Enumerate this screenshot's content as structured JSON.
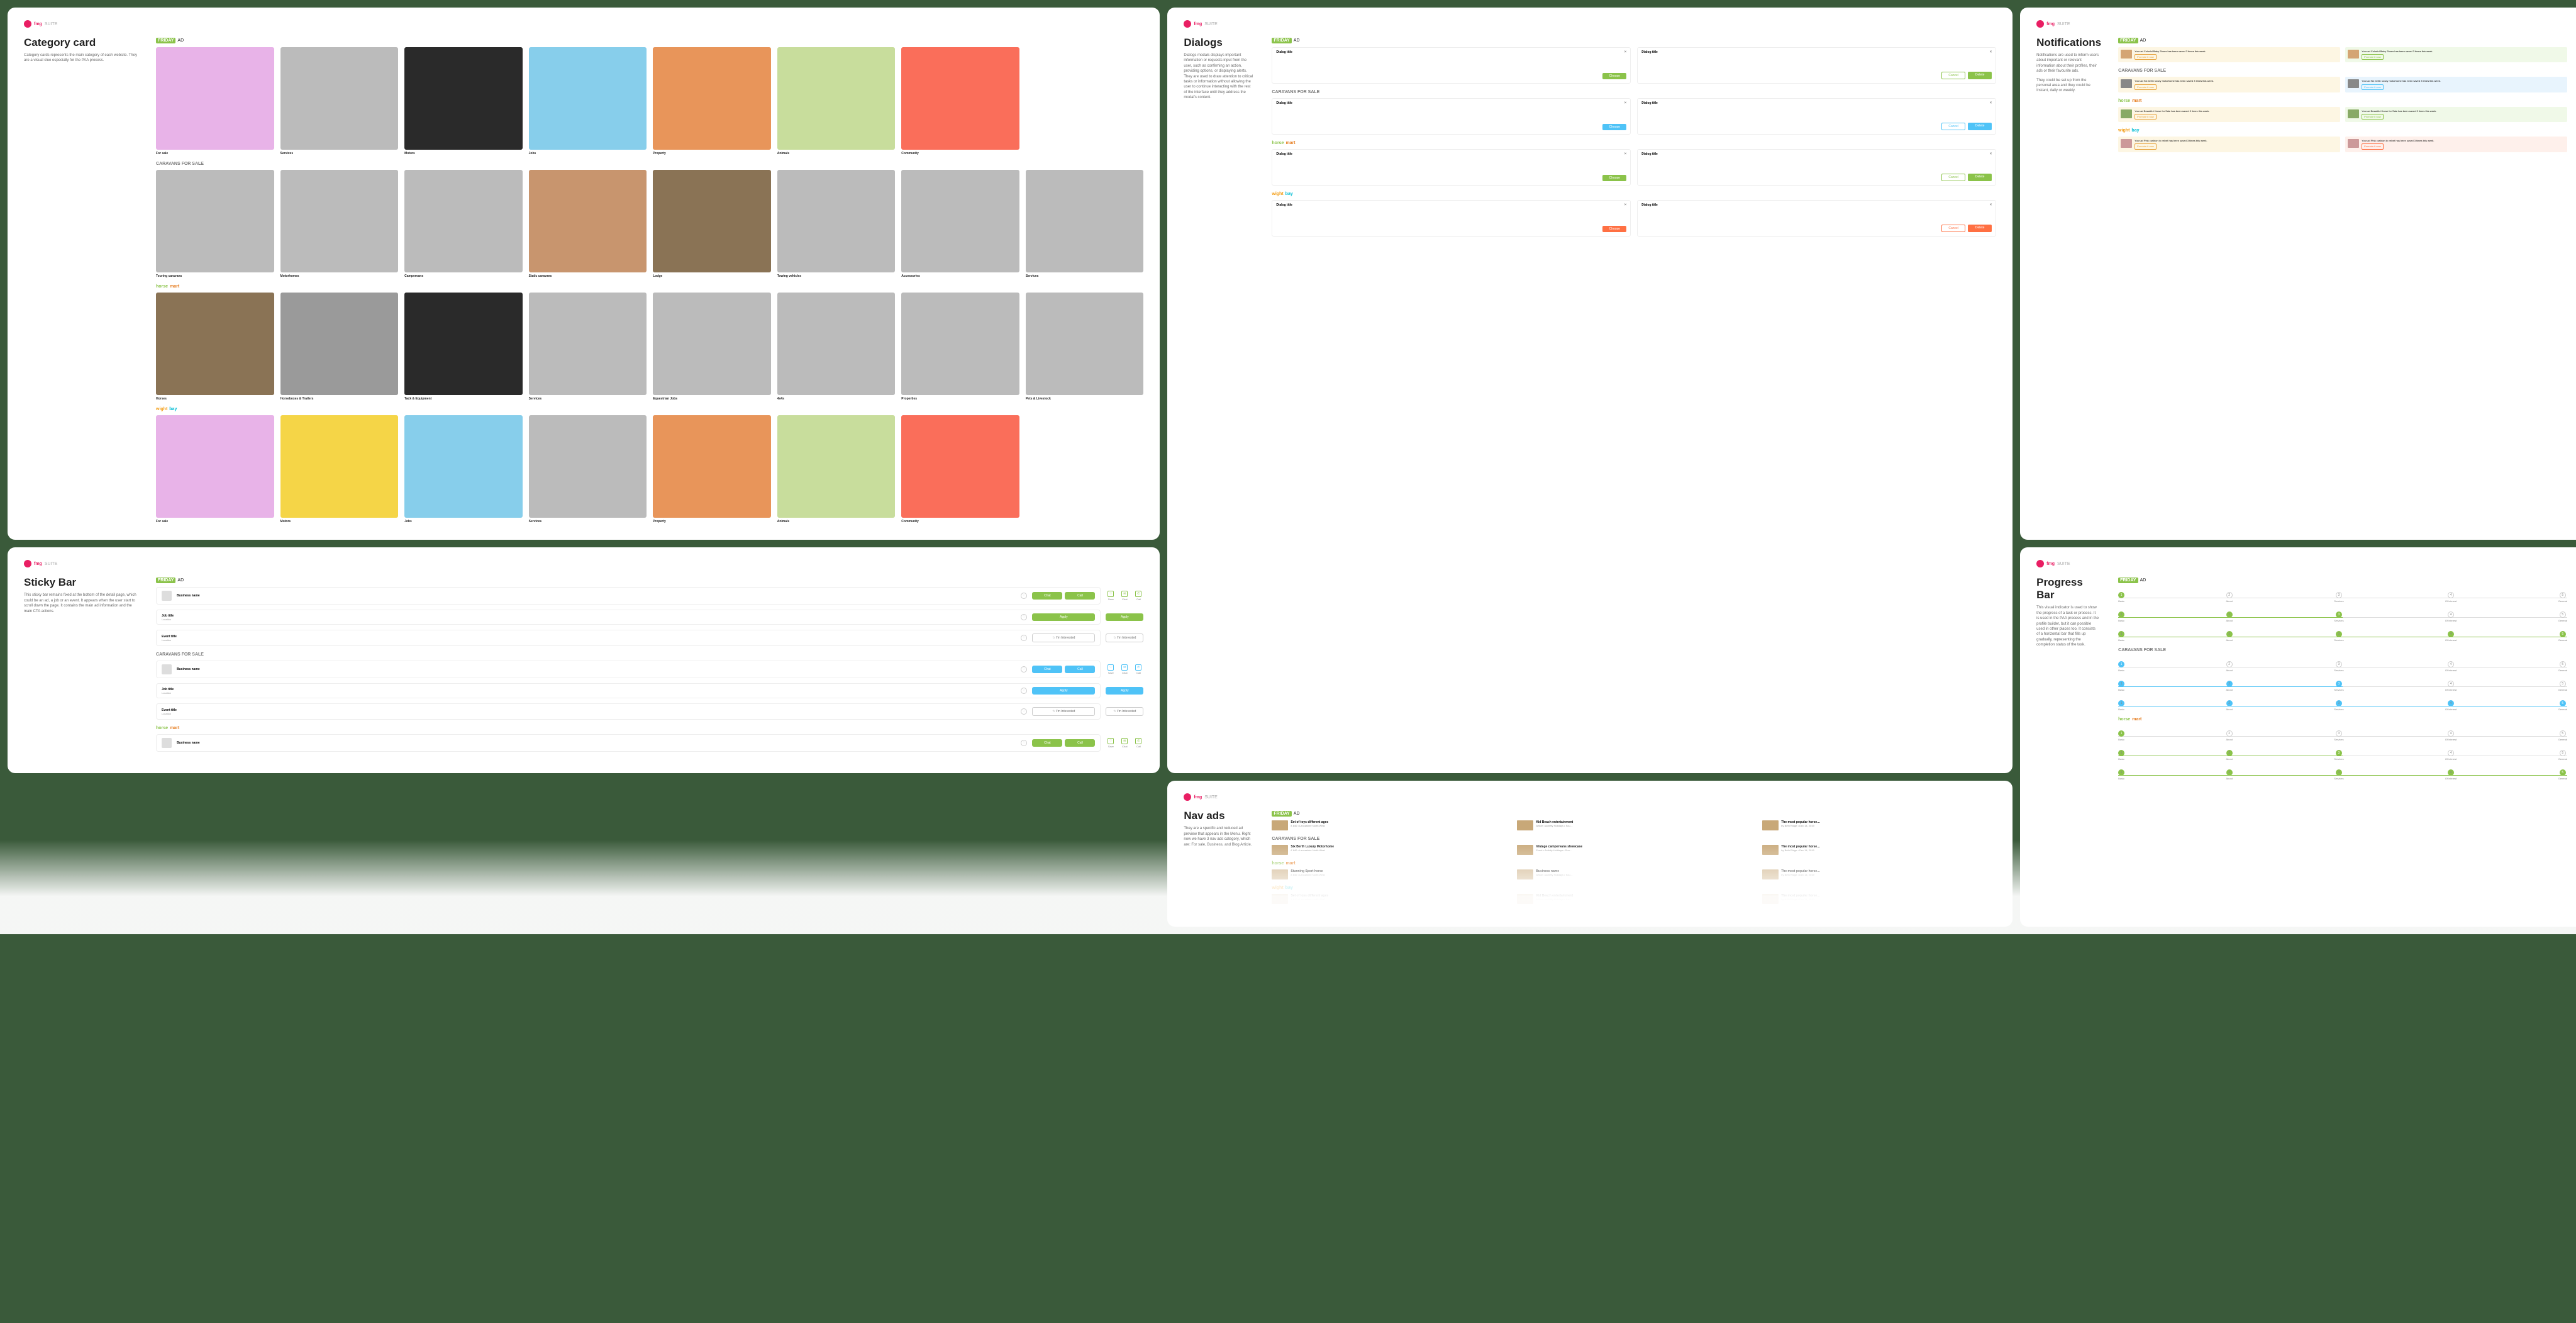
{
  "logo": {
    "brand": "fmg",
    "sub": "SUITE"
  },
  "brands": {
    "friday": "FRIDAY",
    "fridayAd": "AD",
    "caravans": "CARAVANS FOR SALE",
    "horsemart": "horsemart",
    "wightbay": "wightbay"
  },
  "categoryCard": {
    "title": "Category card",
    "desc": "Category cards represents the main category of each website. They are a visual clue especially for the PAA process.",
    "r1": [
      {
        "l": "For sale",
        "c": "c-pink"
      },
      {
        "l": "Services",
        "c": "c-gray"
      },
      {
        "l": "Motors",
        "c": "c-dark"
      },
      {
        "l": "Jobs",
        "c": "c-blue"
      },
      {
        "l": "Property",
        "c": "c-orange"
      },
      {
        "l": "Animals",
        "c": "c-green"
      },
      {
        "l": "Community",
        "c": "c-salmon"
      }
    ],
    "r2": [
      {
        "l": "Touring caravans",
        "c": "c-gray"
      },
      {
        "l": "Motorhomes",
        "c": "c-gray"
      },
      {
        "l": "Campervans",
        "c": "c-gray"
      },
      {
        "l": "Static caravans",
        "c": "c-warm"
      },
      {
        "l": "Lodge",
        "c": "c-brown"
      },
      {
        "l": "Towing vehicles",
        "c": "c-gray"
      },
      {
        "l": "Accessories",
        "c": "c-gray"
      },
      {
        "l": "Services",
        "c": "c-gray"
      }
    ],
    "r3": [
      {
        "l": "Horses",
        "c": "c-brown"
      },
      {
        "l": "Horseboxes & Trailers",
        "c": "c-grayish"
      },
      {
        "l": "Tack & Equipment",
        "c": "c-dark"
      },
      {
        "l": "Services",
        "c": "c-gray"
      },
      {
        "l": "Equestrian Jobs",
        "c": "c-gray"
      },
      {
        "l": "4x4s",
        "c": "c-gray"
      },
      {
        "l": "Properties",
        "c": "c-gray"
      },
      {
        "l": "Pets & Livestock",
        "c": "c-gray"
      }
    ],
    "r4": [
      {
        "l": "For sale",
        "c": "c-pink"
      },
      {
        "l": "Motors",
        "c": "c-yellow"
      },
      {
        "l": "Jobs",
        "c": "c-blue"
      },
      {
        "l": "Services",
        "c": "c-gray"
      },
      {
        "l": "Property",
        "c": "c-orange"
      },
      {
        "l": "Animals",
        "c": "c-green"
      },
      {
        "l": "Community",
        "c": "c-salmon"
      }
    ]
  },
  "stickyBar": {
    "title": "Sticky Bar",
    "desc": "This sticky bar remains fixed at the bottom of the detail page, which could be an ad, a job or an event. It appears when the user start to scroll down the page. It contains the main ad information and the main CTA actions.",
    "fields": {
      "business": "Business name",
      "job": "Job title",
      "event": "Event title",
      "loc": "Location"
    },
    "btns": {
      "chat": "Chat",
      "call": "Call",
      "apply": "Apply",
      "interested": "I’m Interested",
      "save": "Save"
    }
  },
  "dialogs": {
    "title": "Dialogs",
    "desc": "Dialogs modals displays important information or requests input from the user, such as confirming an action, providing options, or displaying alerts. They are used to draw attention to critical tasks or information without allowing the user to continue interacting with the rest of the interface until they address the modal's content.",
    "heading": "Dialog title",
    "btns": {
      "choose": "Choose",
      "cancel": "Cancel",
      "delete": "Delete"
    }
  },
  "notifications": {
    "title": "Notifications",
    "desc": "Notifications are used to inform users about important or relevant information about their profiles, their ads or their favourite ads.",
    "desc2": "They could be set up from the personal area and they could be Instant, daily or weekly.",
    "items": {
      "baby": "Your ad Colorful Baby Shoes has been saved 3 times this week.",
      "moto": "Your ad Six berth luxury motorhome has been saved 3 times this week.",
      "horse": "Your ad Beautiful Horse for Sale has been saved 3 times this week.",
      "cushion": "Your ad Pink cushion in velvet has been saved 3 times this week."
    },
    "promote": "Promote it now"
  },
  "progress": {
    "title": "Progress Bar",
    "desc": "This visual indicator is used to show the progress of a task or process. It is used in the PAA process and in the profile builder, but it can possible used in other places too. It consists of a horizontal bar that fills up gradually, representing the completion status of the task.",
    "steps": [
      "Basic",
      "About",
      "Services",
      "Of interest",
      "General"
    ]
  },
  "navads": {
    "title": "Nav ads",
    "desc": "They are a specific and reduced ad preview that appears in the Menu. Right now we have 3 nav ads category, which are: For sale, Business, and Blog Article.",
    "r1": [
      {
        "t": "Set of toys different ages",
        "s": "£ 840 • Lancashire North West"
      },
      {
        "t": "Kid Beach entertainment",
        "s": "Article • Activity Holidays • Sou…"
      },
      {
        "t": "The most popular horse…",
        "s": "by Beth Ridge • Dec 14, 2019"
      }
    ],
    "r2": [
      {
        "t": "Six Berth Luxury Motorhome",
        "s": "£ 840 • Lancashire North West"
      },
      {
        "t": "Vintage campervans showcase",
        "s": "Event • Activity Holidays • Sou…"
      },
      {
        "t": "The most popular horse…",
        "s": "by Beth Ridge • Dec 14, 2019"
      }
    ],
    "r3": [
      {
        "t": "Stunning Sport horse",
        "s": "£ 840 • Lancashire North West"
      },
      {
        "t": "Business name",
        "s": "Article • Activity Holidays • Sou…"
      },
      {
        "t": "The most popular horse…",
        "s": "by Beth Ridge • Dec 14, 2019"
      }
    ]
  }
}
